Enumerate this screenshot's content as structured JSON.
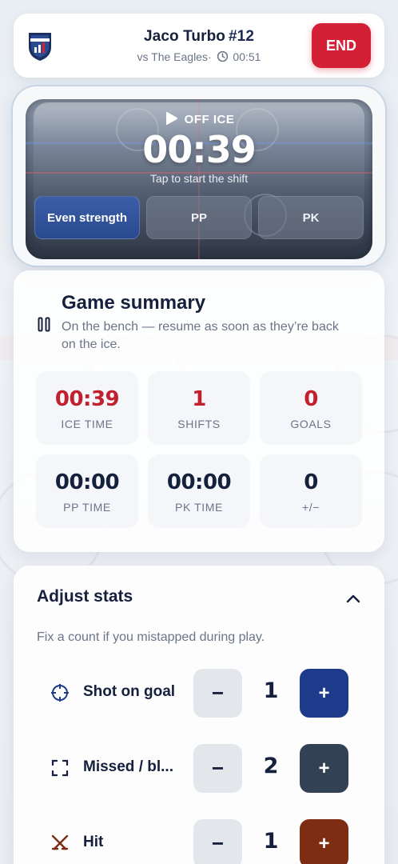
{
  "header": {
    "player_name": "Jaco Turbo",
    "player_number": "#12",
    "opponent": "vs The Eagles·",
    "game_clock": "00:51",
    "end_label": "END"
  },
  "shift": {
    "state": "OFF ICE",
    "timer": "00:39",
    "hint": "Tap to start the shift",
    "strengths": [
      "Even strength",
      "PP",
      "PK"
    ],
    "active_strength": "Even strength"
  },
  "summary": {
    "title": "Game summary",
    "subtitle": "On the bench — resume as soon as they’re back on the ice.",
    "stats": [
      {
        "value": "00:39",
        "label": "ICE TIME"
      },
      {
        "value": "1",
        "label": "SHIFTS"
      },
      {
        "value": "0",
        "label": "GOALS"
      },
      {
        "value": "00:00",
        "label": "PP TIME"
      },
      {
        "value": "00:00",
        "label": "PK TIME"
      },
      {
        "value": "0",
        "label": "+/−"
      }
    ]
  },
  "adjust": {
    "title": "Adjust stats",
    "subtitle": "Fix a count if you mistapped during play.",
    "minus_label": "−",
    "plus_label": "+",
    "rows": [
      {
        "label": "Shot on goal",
        "count": "1",
        "icon": "crosshair-icon",
        "plus_color": "#1e3a8a"
      },
      {
        "label": "Missed / bl...",
        "count": "2",
        "icon": "corners-icon",
        "plus_color": "#334155"
      },
      {
        "label": "Hit",
        "count": "1",
        "icon": "crossed-sticks-icon",
        "plus_color": "#7c2d12"
      }
    ]
  },
  "colors": {
    "accent_red": "#d32035",
    "navy": "#15203d"
  }
}
